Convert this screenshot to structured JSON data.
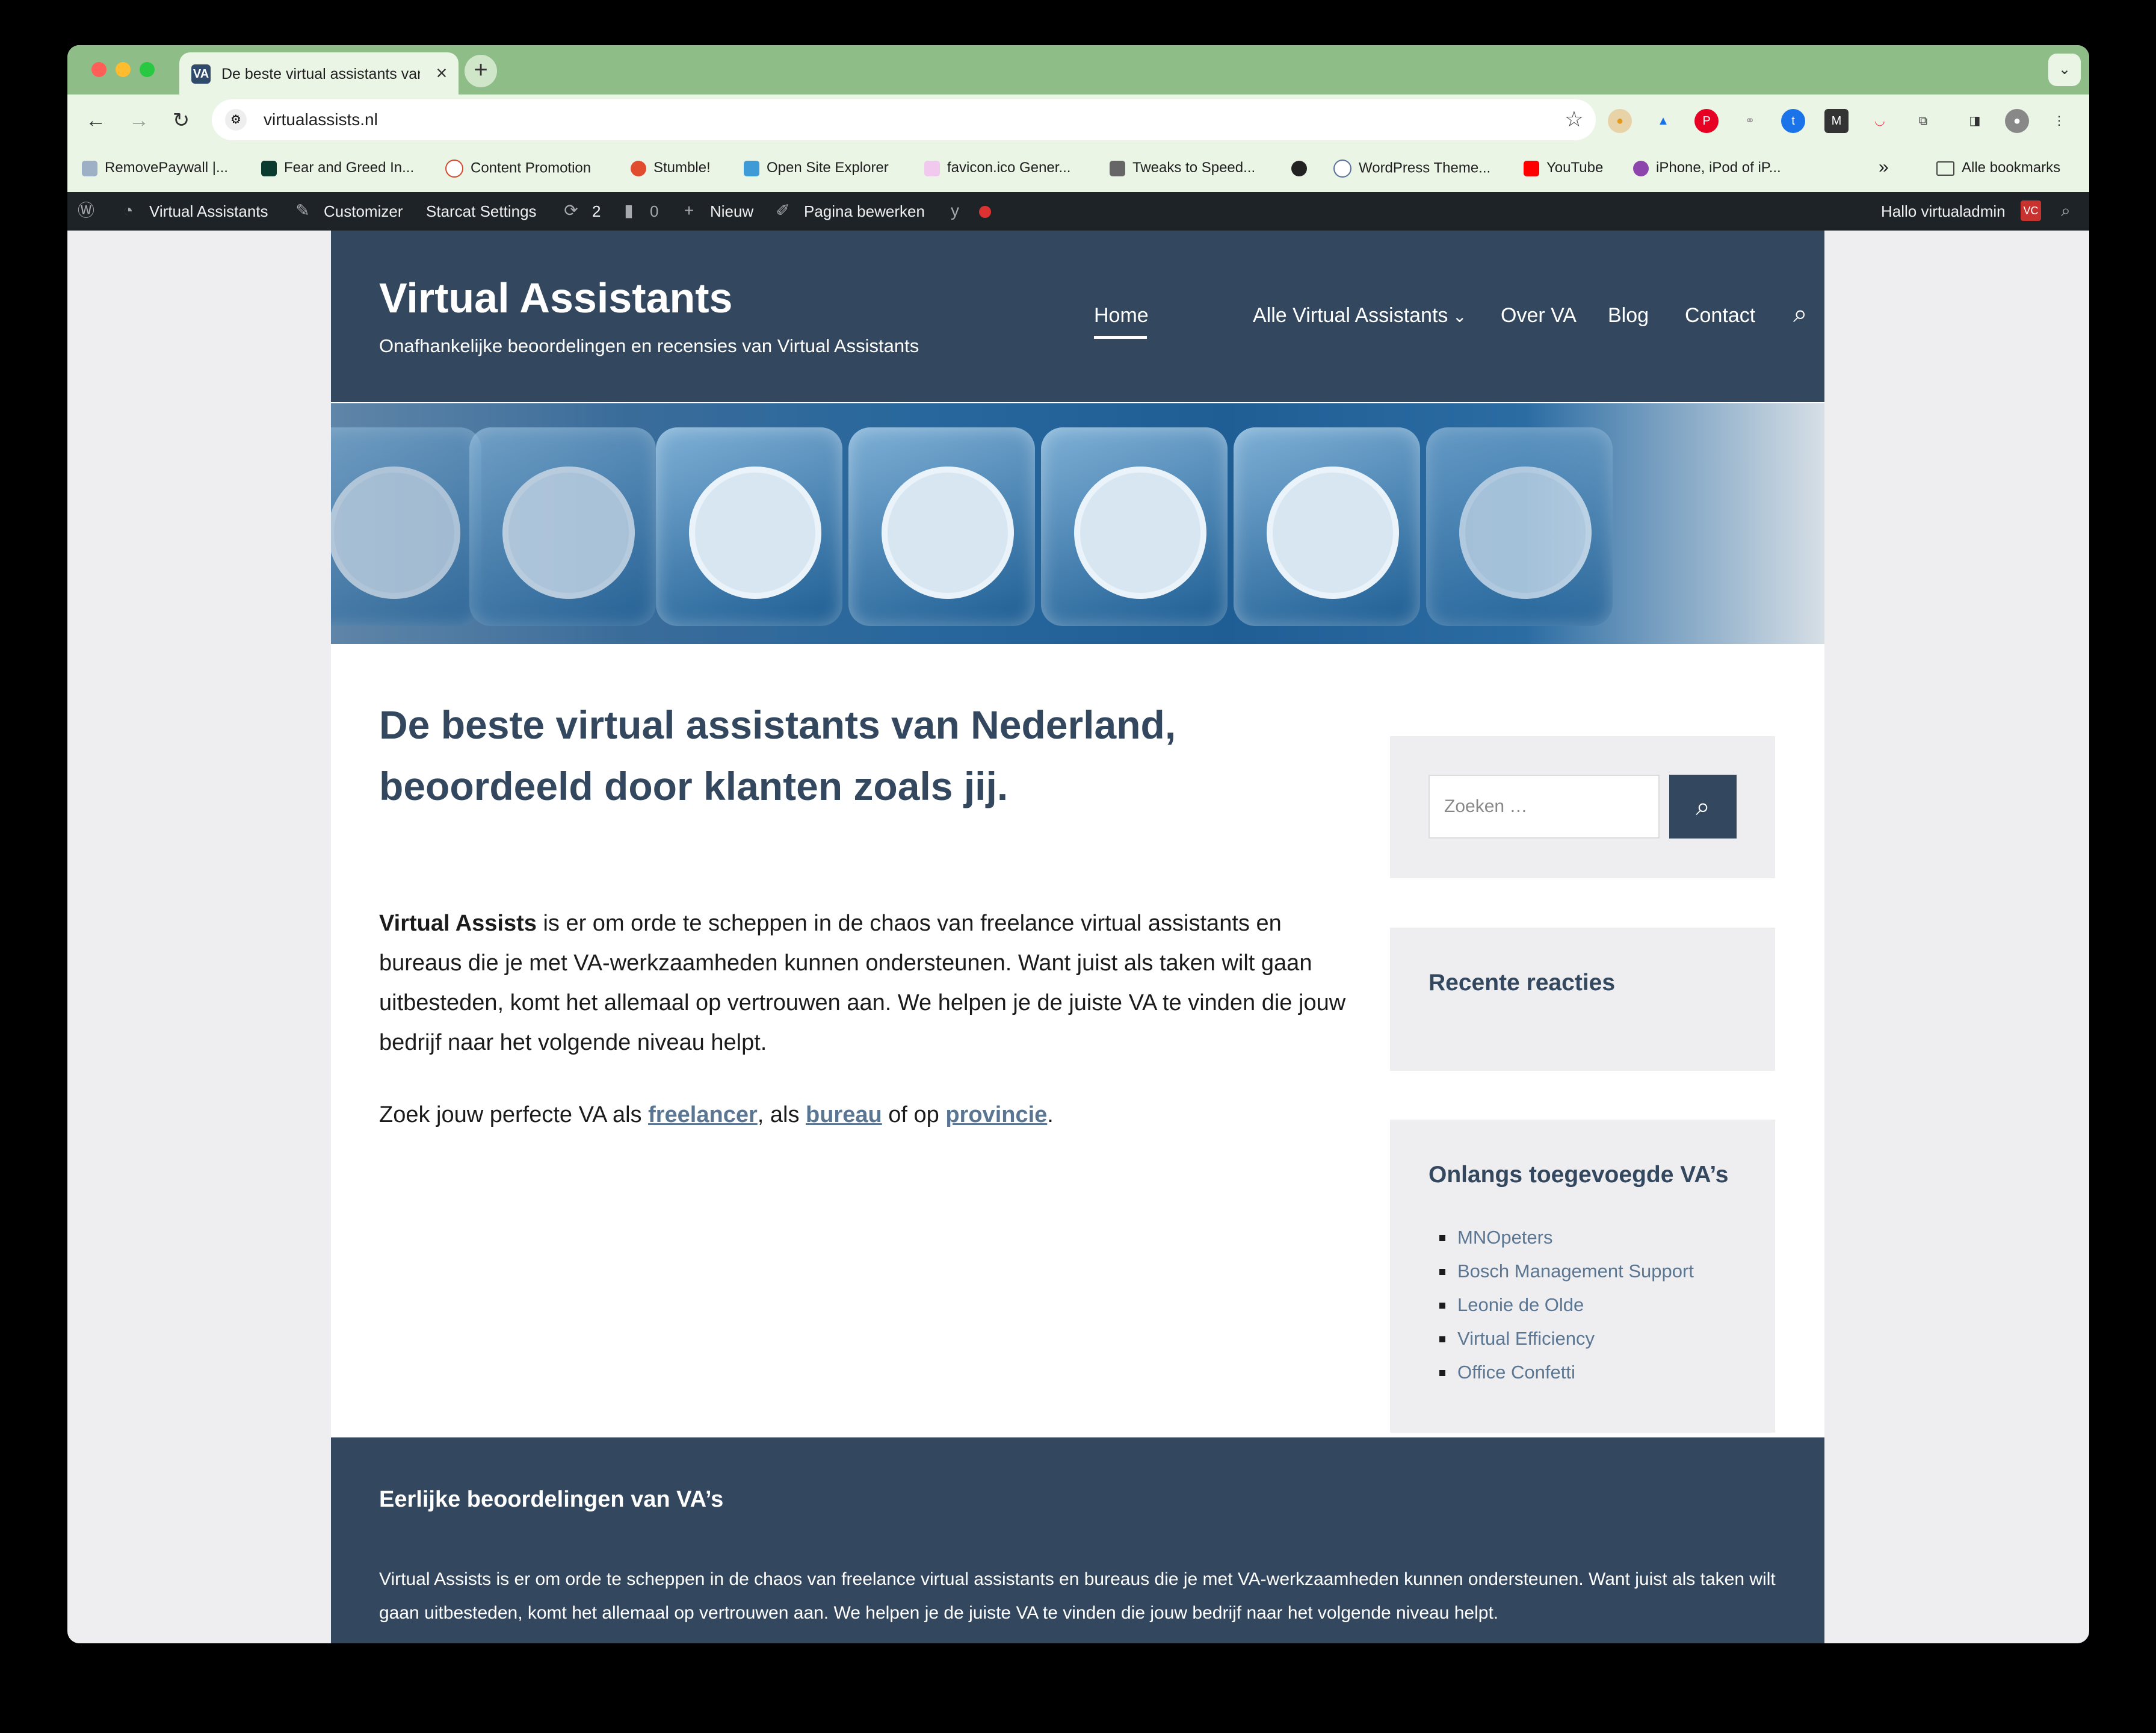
{
  "browser": {
    "tab_title": "De beste virtual assistants van",
    "tab_favicon": "VA",
    "url": "virtualassists.nl",
    "bookmarks": [
      "RemovePaywall |...",
      "Fear and Greed In...",
      "Content Promotion",
      "Stumble!",
      "Open Site Explorer",
      "favicon.ico Gener...",
      "Tweaks to Speed...",
      "WordPress Theme...",
      "YouTube",
      "iPhone, iPod of iP..."
    ],
    "all_bookmarks": "Alle bookmarks",
    "more_bookmarks": "»"
  },
  "adminbar": {
    "site_name": "Virtual Assistants",
    "customizer": "Customizer",
    "starcat": "Starcat Settings",
    "updates": "2",
    "comments": "0",
    "new": "Nieuw",
    "edit": "Pagina bewerken",
    "greeting": "Hallo virtualadmin"
  },
  "site": {
    "title": "Virtual Assistants",
    "tagline": "Onafhankelijke beoordelingen en recensies van Virtual Assistants",
    "nav": [
      "Home",
      "Alle Virtual Assistants",
      "Over VA",
      "Blog",
      "Contact"
    ]
  },
  "content": {
    "heading": "De beste virtual assistants van Nederland, beoordeeld door klanten zoals jij.",
    "intro_bold": "Virtual Assists",
    "intro_rest": " is er om orde te scheppen in de chaos van freelance virtual assistants en bureaus die je met VA-werkzaamheden kunnen ondersteunen. Want juist als taken wilt gaan uitbesteden, komt het allemaal op vertrouwen aan. We helpen je de juiste VA te vinden die jouw bedrijf naar het volgende niveau helpt.",
    "search_prefix": "Zoek jouw perfecte VA als ",
    "link_freelancer": "freelancer",
    "search_mid1": ", als ",
    "link_bureau": "bureau",
    "search_mid2": " of op ",
    "link_provincie": "provincie",
    "search_suffix": "."
  },
  "sidebar": {
    "search_placeholder": "Zoeken …",
    "recent_comments_title": "Recente reacties",
    "recent_va_title": "Onlangs toegevoegde VA’s",
    "recent_va": [
      "MNOpeters",
      "Bosch Management Support",
      "Leonie de Olde",
      "Virtual Efficiency",
      "Office Confetti"
    ]
  },
  "footer": {
    "title": "Eerlijke beoordelingen van VA’s",
    "text": "Virtual Assists is er om orde te scheppen in de chaos van freelance virtual assistants en bureaus die je met VA-werkzaamheden kunnen ondersteunen. Want juist als taken wilt gaan uitbesteden, komt het allemaal op vertrouwen aan. We helpen je de juiste VA te vinden die jouw bedrijf naar het volgende niveau helpt."
  },
  "colors": {
    "header_bg": "#33475e",
    "link": "#5b7692",
    "tabbar": "#8fbd88"
  }
}
